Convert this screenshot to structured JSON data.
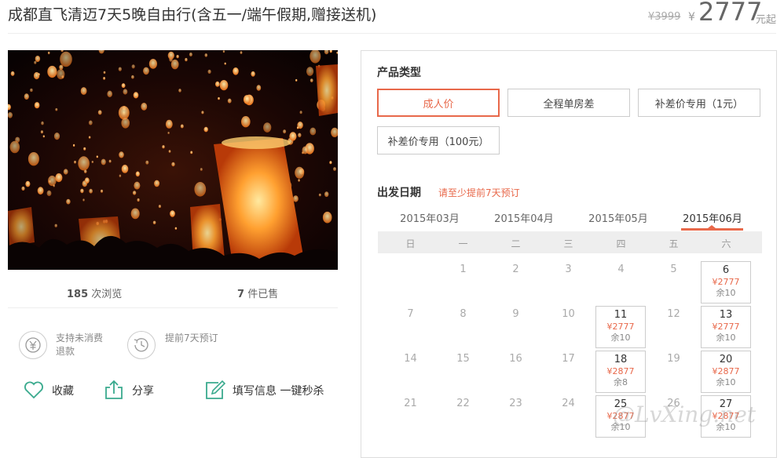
{
  "header": {
    "title": "成都直飞清迈7天5晚自由行(含五一/端午假期,赠接送机)",
    "price_original": "¥3999",
    "price_symbol": "¥",
    "price_current": "2777",
    "price_unit": "元起"
  },
  "stats": {
    "views_count": "185",
    "views_label": "次浏览",
    "sold_count": "7",
    "sold_label": "件已售"
  },
  "features": [
    {
      "icon": "yen-refund-icon",
      "label": "支持未消费退款"
    },
    {
      "icon": "clock-history-icon",
      "label": "提前7天预订"
    }
  ],
  "actions": {
    "favorite": "收藏",
    "share": "分享",
    "fill_info": "填写信息 一键秒杀"
  },
  "product_type": {
    "label": "产品类型",
    "options": [
      "成人价",
      "全程单房差",
      "补差价专用（1元）",
      "补差价专用（100元）"
    ],
    "selected": 0
  },
  "departure": {
    "label": "出发日期",
    "note": "请至少提前7天预订",
    "months": [
      "2015年03月",
      "2015年04月",
      "2015年05月",
      "2015年06月"
    ],
    "selected_month": 3,
    "weekdays": [
      "日",
      "一",
      "二",
      "三",
      "四",
      "五",
      "六"
    ],
    "rows": [
      [
        "",
        "1",
        "2",
        "3",
        "4",
        "5",
        "6"
      ],
      [
        "7",
        "8",
        "9",
        "10",
        "11",
        "12",
        "13"
      ],
      [
        "14",
        "15",
        "16",
        "17",
        "18",
        "19",
        "20"
      ],
      [
        "21",
        "22",
        "23",
        "24",
        "25",
        "26",
        "27"
      ]
    ],
    "available": [
      {
        "day": "6",
        "price": "¥2777",
        "remain": "余10"
      },
      {
        "day": "11",
        "price": "¥2777",
        "remain": "余10"
      },
      {
        "day": "13",
        "price": "¥2777",
        "remain": "余10"
      },
      {
        "day": "18",
        "price": "¥2877",
        "remain": "余8"
      },
      {
        "day": "20",
        "price": "¥2877",
        "remain": "余10"
      },
      {
        "day": "25",
        "price": "¥2877",
        "remain": "余10"
      },
      {
        "day": "27",
        "price": "¥2877",
        "remain": "余10"
      }
    ]
  },
  "colors": {
    "accent": "#e8684a",
    "border": "#cccccc",
    "week_bg": "#eeeeee"
  },
  "watermark": "@LvXing.net"
}
